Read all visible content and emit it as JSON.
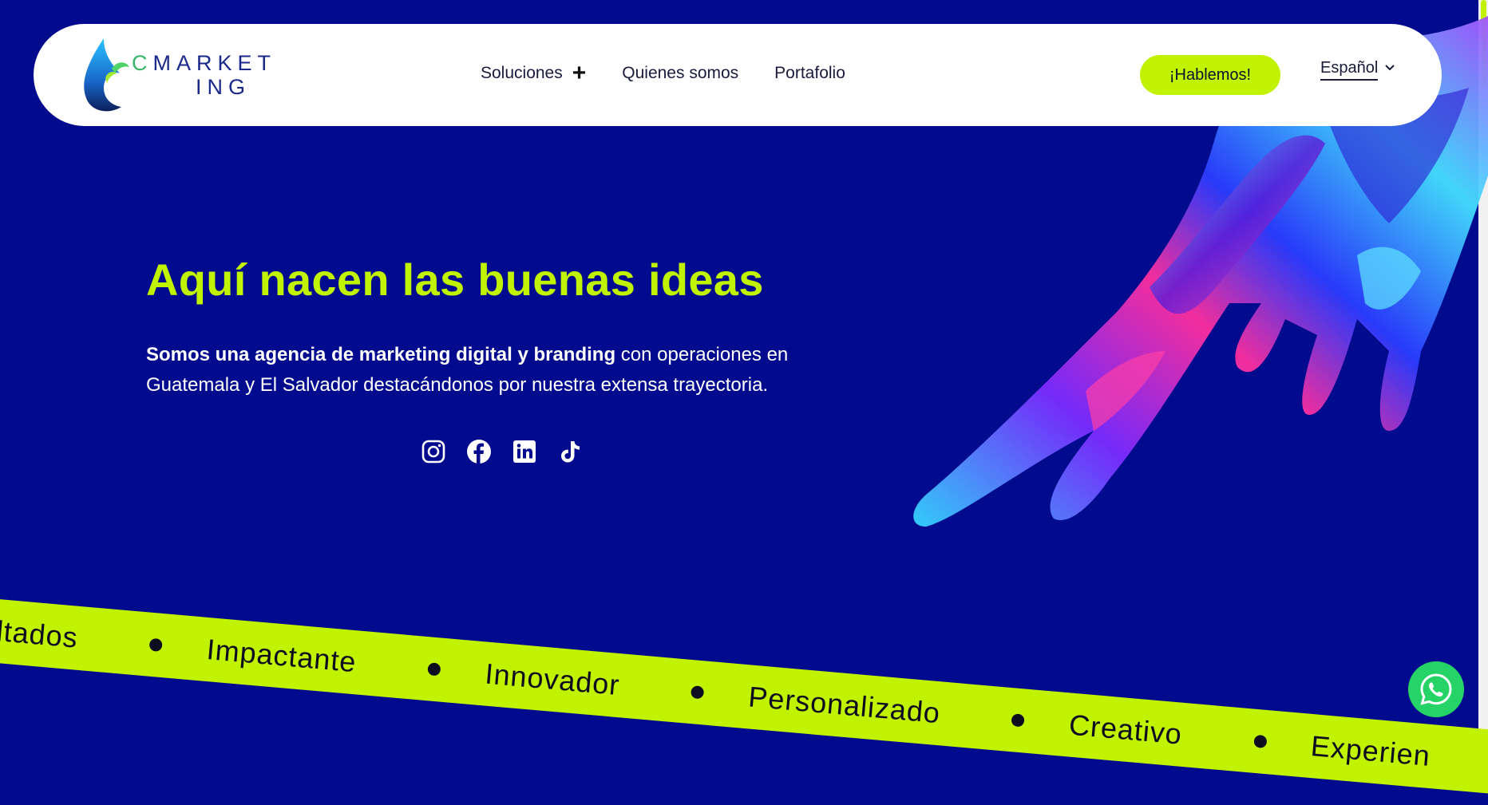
{
  "brand": {
    "logo_line1_accent": "C",
    "logo_line1_rest": "MARKET",
    "logo_line2": "ING"
  },
  "nav": {
    "items": [
      {
        "label": "Soluciones"
      },
      {
        "label": "Quienes somos"
      },
      {
        "label": "Portafolio"
      }
    ],
    "cta_label": "¡Hablemos!",
    "language": "Español"
  },
  "hero": {
    "title": "Aquí nacen las buenas ideas",
    "text_bold": "Somos una agencia de marketing digital y branding",
    "text_rest": " con operaciones en Guatemala y El Salvador destacándonos por nuestra extensa trayectoria."
  },
  "socials": [
    {
      "icon": "instagram-icon"
    },
    {
      "icon": "facebook-icon"
    },
    {
      "icon": "linkedin-icon"
    },
    {
      "icon": "tiktok-icon"
    }
  ],
  "ticker": {
    "words": [
      "ltados",
      "Impactante",
      "Innovador",
      "Personalizado",
      "Creativo",
      "Experien"
    ]
  },
  "colors": {
    "background": "#020b8d",
    "accent": "#c1f200",
    "navbar": "#ffffff",
    "whatsapp": "#25d366"
  }
}
